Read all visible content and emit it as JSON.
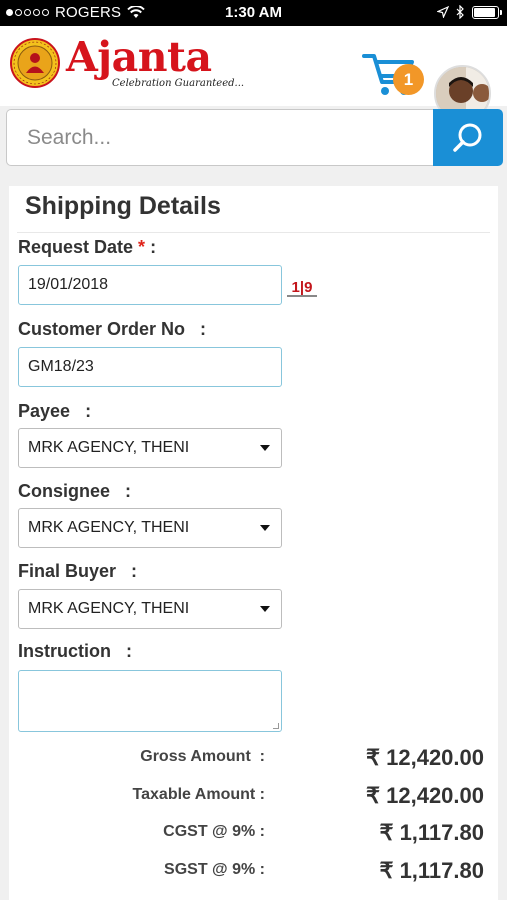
{
  "status_bar": {
    "carrier": "ROGERS",
    "time": "1:30 AM"
  },
  "header": {
    "brand": "Ajanta",
    "tagline": "Celebration Guaranteed...",
    "cart_count": "1"
  },
  "search": {
    "placeholder": "Search..."
  },
  "shipping": {
    "title": "Shipping Details",
    "request_date_label": "Request Date",
    "required_marker": "*",
    "colon": ":",
    "request_date_value": "19/01/2018",
    "calendar_icon_text": "1|9",
    "customer_order_label": "Customer Order No",
    "customer_order_value": "GM18/23",
    "payee_label": "Payee",
    "payee_value": "MRK AGENCY, THENI",
    "consignee_label": "Consignee",
    "consignee_value": "MRK AGENCY, THENI",
    "final_buyer_label": "Final Buyer",
    "final_buyer_value": "MRK AGENCY, THENI",
    "instruction_label": "Instruction",
    "instruction_value": ""
  },
  "totals": [
    {
      "label": "Gross Amount  :",
      "value": "₹ 12,420.00"
    },
    {
      "label": "Taxable Amount :",
      "value": "₹ 12,420.00"
    },
    {
      "label": "CGST @ 9% :",
      "value": "₹ 1,117.80"
    },
    {
      "label": "SGST @ 9% :",
      "value": "₹ 1,117.80"
    }
  ],
  "colors": {
    "brand_red": "#d6141c",
    "accent_blue": "#1a8fd6",
    "badge_orange": "#f29728",
    "field_border": "#88c6dc"
  }
}
